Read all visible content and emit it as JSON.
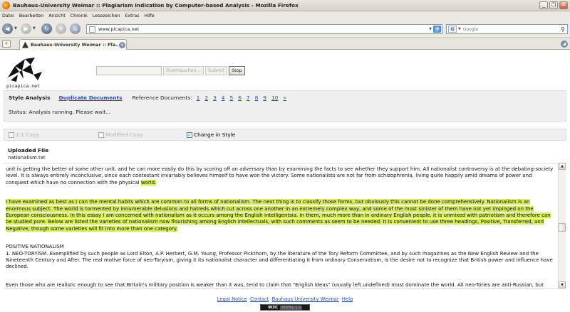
{
  "window": {
    "title": "Bauhaus-University Weimar :: Plagiarism Indication by Computer-based Analysis - Mozilla Firefox"
  },
  "menu": [
    "Datei",
    "Bearbeiten",
    "Ansicht",
    "Chronik",
    "Lesezeichen",
    "Extras",
    "Hilfe"
  ],
  "address": {
    "url": "www.picapica.net"
  },
  "websearch": {
    "placeholder": "Google"
  },
  "tab": {
    "title": "Bauhaus-University Weimar :: Pla..."
  },
  "logo": {
    "text": "picapica.net"
  },
  "search_form": {
    "browse": "Durchsuchen...",
    "submit": "Submit",
    "stop": "Stop"
  },
  "analysis": {
    "style_label": "Style Analysis",
    "duplicate_link": "Duplicate Documents",
    "reference_label": "Reference Documents:",
    "pages": [
      "1",
      "2",
      "3",
      "4",
      "5",
      "6",
      "7",
      "8",
      "9",
      "10",
      "»"
    ],
    "status": "Status: Analysis running. Please wait..."
  },
  "filters": {
    "one_to_one": "1:1 Copy",
    "modified": "Modified Copy",
    "change_style": "Change in Style",
    "change_style_checked": true
  },
  "upload": {
    "heading": "Uploaded File",
    "filename": "nationalism.txt"
  },
  "document": {
    "p1": "unit is getting the better of some other unit, and he can more easily do this by scoring off an adversary than by examining the facts to see whether they support him. All nationalist controversy is at the debating-society level. It is always entirely inconclusive, since each contestant invariably believes himself to have won the victory. Some nationalists are not far from schizophrenia, living quite happily amid dreams of power and conquest which have no connection with the physical ",
    "p1_hl": "world.",
    "p2": "I have examined as best as I can the mental habits which are common to all forms of nationalism. The next thing is to classify those forms, but obviously this cannot be done comprehensively. Nationalism is an enormous subject. The world is tormented by innumerable delusions and hatreds which cut across one another in an extremely complex way, and some of the most sinister of them have not yet impinged on the European consciousness. In this essay I am concerned with nationalism as it occurs among the English intelligentsia. In them, much more than in ordinary English people, it is unmixed with patriotism and therefore can be studied pure. Below are listed the varieties of nationalism now flourishing among English intellectuals, with such comments as seem to be needed. It is convenient to use three headings, Positive, Transferred, and Negative, though some varieties will fit into more than one category.",
    "p3": "POSITIVE NATIONALISM",
    "p4": "1. NEO-TORYISM. Exemplified by such people as Lord Elton, A.P. Herbert, G.M. Young, Professor Pickthorn, by the literature of the Tory Reform Committee, and by such magazines as the New English Review and the Nineteenth Century and After. The real motive force of neo-Toryism, giving it its nationalist character and differentiating it from ordinary Conservatism, is the desire not to recognize that British power and influence have declined.",
    "p5": "Even those who are realistic enough to see that Britain's military position is weaker than it was, tend to claim that \"English ideas\" (usually left undefined) must dominate the world. All neo-Tories are anti-Russian, but sometimes the main emphasis is anti-American."
  },
  "footer": {
    "legal": "Legal Notice",
    "contact": "Contact",
    "bauhaus": "Bauhaus University Weimar",
    "help": "Help",
    "badge_w3c": "W3C",
    "badge_xhtml": "XHTML 1.1"
  }
}
